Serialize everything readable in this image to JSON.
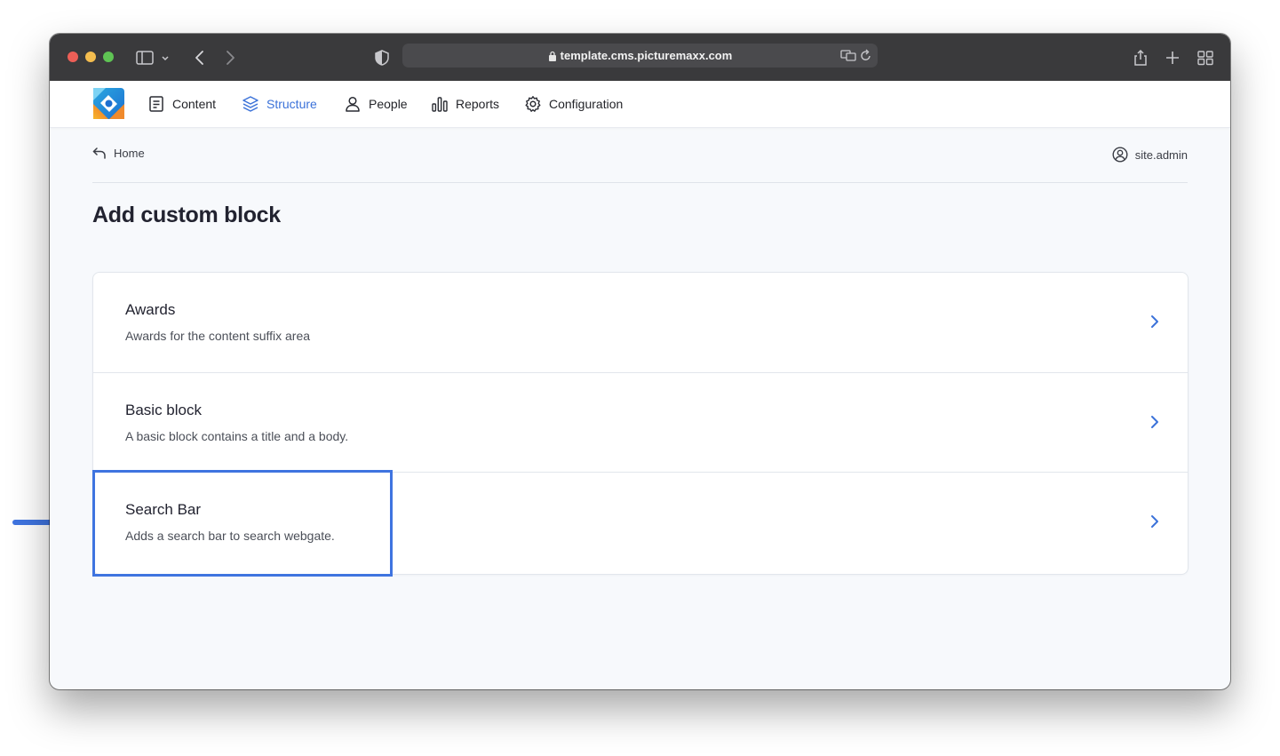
{
  "browser": {
    "url": "template.cms.picturemaxx.com",
    "traffic_lights": [
      "#ed5f57",
      "#f4bd4f",
      "#5fc454"
    ]
  },
  "nav": {
    "items": [
      {
        "label": "Content",
        "icon": "document-icon"
      },
      {
        "label": "Structure",
        "icon": "layers-icon",
        "active": true
      },
      {
        "label": "People",
        "icon": "person-icon"
      },
      {
        "label": "Reports",
        "icon": "bar-chart-icon"
      },
      {
        "label": "Configuration",
        "icon": "gear-icon"
      }
    ],
    "active_color": "#3b72d9"
  },
  "breadcrumb": {
    "home_label": "Home",
    "user_label": "site.admin"
  },
  "page": {
    "title": "Add custom block"
  },
  "blocks": [
    {
      "title": "Awards",
      "description": "Awards for the content suffix area"
    },
    {
      "title": "Basic block",
      "description": "A basic block contains a title and a body."
    },
    {
      "title": "Search Bar",
      "description": "Adds a search bar to search webgate."
    }
  ],
  "annotation": {
    "highlight_color": "#3f74e0",
    "highlighted_item": "Search Bar"
  }
}
